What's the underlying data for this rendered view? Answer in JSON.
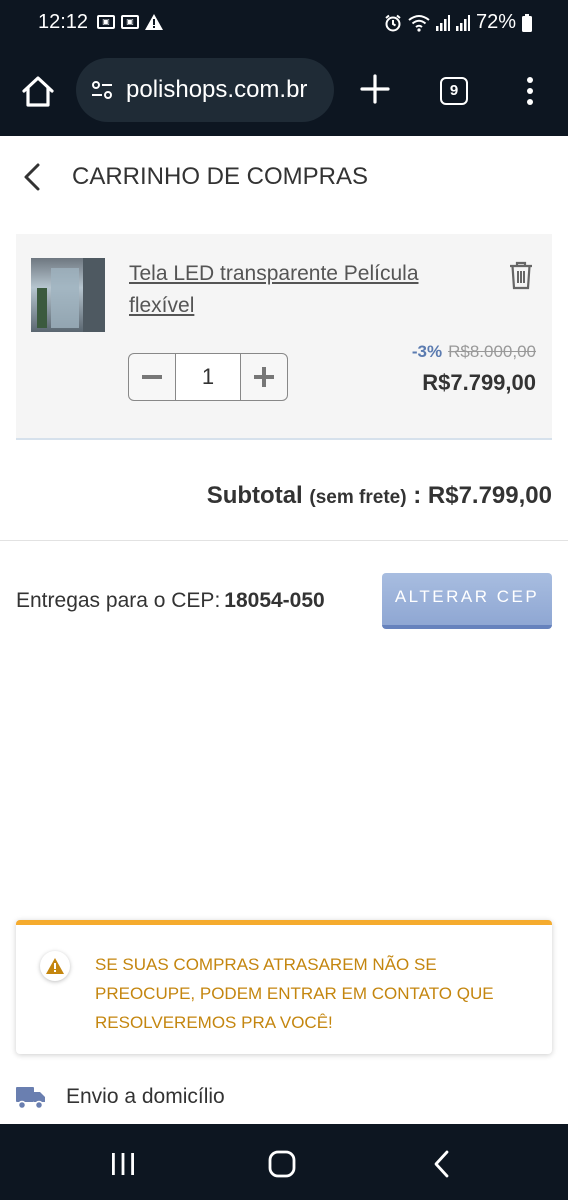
{
  "status_bar": {
    "time": "12:12",
    "battery": "72%"
  },
  "browser": {
    "url": "polishops.com.br",
    "tab_count": "9"
  },
  "page": {
    "title": "CARRINHO DE COMPRAS"
  },
  "cart": {
    "items": [
      {
        "name": "Tela LED transparente Película flexível",
        "quantity": "1",
        "discount": "-3%",
        "old_price": "R$8.000,00",
        "price": "R$7.799,00"
      }
    ]
  },
  "subtotal": {
    "label": "Subtotal",
    "note": "(sem frete)",
    "separator": ":",
    "value": "R$7.799,00"
  },
  "delivery": {
    "label": "Entregas para o CEP:",
    "cep": "18054-050",
    "change_button": "ALTERAR CEP"
  },
  "alert": {
    "text": "SE SUAS COMPRAS ATRASAREM NÃO SE PREOCUPE, PODEM ENTRAR EM CONTATO QUE RESOLVEREMOS PRA VOCÊ!",
    "color": "#c4860f",
    "border_color": "#f5ab2e"
  },
  "shipping_option": {
    "label": "Envio a domicílio"
  },
  "colors": {
    "dark_bar": "#0d1621",
    "accent_blue": "#8fa7d3",
    "discount_blue": "#5b7bb0"
  }
}
